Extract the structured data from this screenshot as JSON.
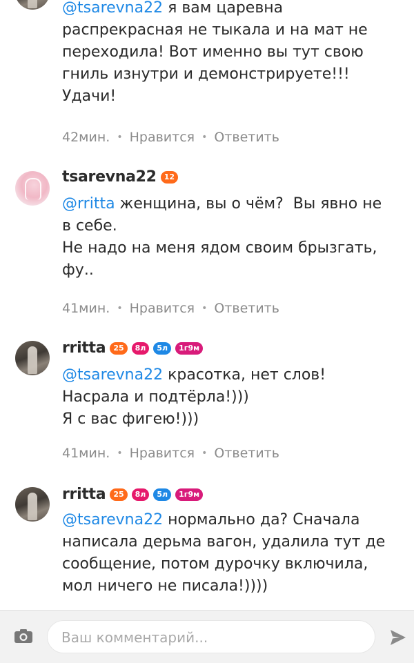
{
  "comments": [
    {
      "avatar": "none",
      "mention": "@tsarevna22",
      "body": " я вам царевна\nраспрекрасная не тыкала и на мат не\nпереходила! Вот именно вы тут свою\nгниль изнутри и демонстрируете!!!\nУдачи!",
      "time": "42мин.",
      "like_label": "Нравится",
      "reply_label": "Ответить"
    },
    {
      "username": "tsarevna22",
      "avatar": "pink-avatar",
      "badges": [
        {
          "text": "12",
          "color": "#ff6a1a"
        }
      ],
      "mention": "@rritta",
      "body": " женщина, вы о чём?  Вы явно не\nв себе.\nНе надо на меня ядом своим брызгать,\nфу..",
      "time": "41мин.",
      "like_label": "Нравится",
      "reply_label": "Ответить"
    },
    {
      "username": "rritta",
      "avatar": "dark-avatar",
      "badges": [
        {
          "text": "25",
          "color": "#ff6a1a"
        },
        {
          "text": "8л",
          "color": "#e6196b"
        },
        {
          "text": "5л",
          "color": "#1e88e5"
        },
        {
          "text": "1г9м",
          "color": "#d81b7a"
        }
      ],
      "mention": "@tsarevna22",
      "body": " красотка, нет слов!\nНасрала и подтёрла!)))\nЯ с вас фигею!)))",
      "time": "41мин.",
      "like_label": "Нравится",
      "reply_label": "Ответить"
    },
    {
      "username": "rritta",
      "avatar": "dark-avatar",
      "badges": [
        {
          "text": "25",
          "color": "#ff6a1a"
        },
        {
          "text": "8л",
          "color": "#e6196b"
        },
        {
          "text": "5л",
          "color": "#1e88e5"
        },
        {
          "text": "1г9м",
          "color": "#d81b7a"
        }
      ],
      "mention": "@tsarevna22",
      "body": " нормально да? Сначала\nнаписала дерьма вагон, удалила тут де\nсообщение, потом дурочку включила,\nмол ничего не писала!))))"
    }
  ],
  "composer": {
    "placeholder": "Ваш комментарий...",
    "camera_icon": "camera-icon",
    "send_icon": "send-icon"
  },
  "colors": {
    "mention": "#1e88e5",
    "meta": "#8b8b8b",
    "bar_background": "#f2f2f2"
  }
}
